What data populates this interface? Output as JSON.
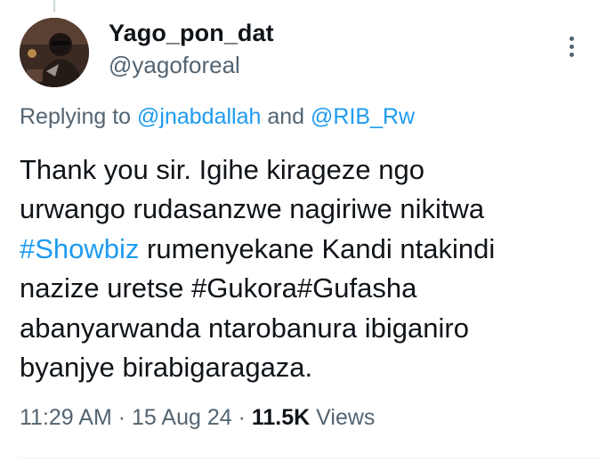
{
  "author": {
    "display_name": "Yago_pon_dat",
    "handle": "@yagoforeal"
  },
  "reply": {
    "prefix": "Replying to",
    "mention_1": "@jnabdallah",
    "joiner": "and",
    "mention_2": "@RIB_Rw"
  },
  "tweet": {
    "line_1": "Thank you sir. Igihe kirageze ngo",
    "line_2": "urwango rudasanzwe nagiriwe nikitwa",
    "line_3_hashtag": "#Showbiz",
    "line_3_rest": "rumenyekane Kandi ntakindi",
    "line_4": "nazize uretse #Gukora#Gufasha",
    "line_5": "abanyarwanda ntarobanura ibiganiro",
    "line_6": "byanjye birabigaragaza."
  },
  "meta": {
    "time": "11:29 AM",
    "separator": "·",
    "date": "15 Aug 24",
    "views_count": "11.5K",
    "views_label": "Views"
  },
  "icons": {
    "more": "more-vertical-icon",
    "avatar": "profile-avatar"
  },
  "colors": {
    "link": "#1d9bf0",
    "secondary_text": "#536471",
    "primary_text": "#0f1419"
  }
}
